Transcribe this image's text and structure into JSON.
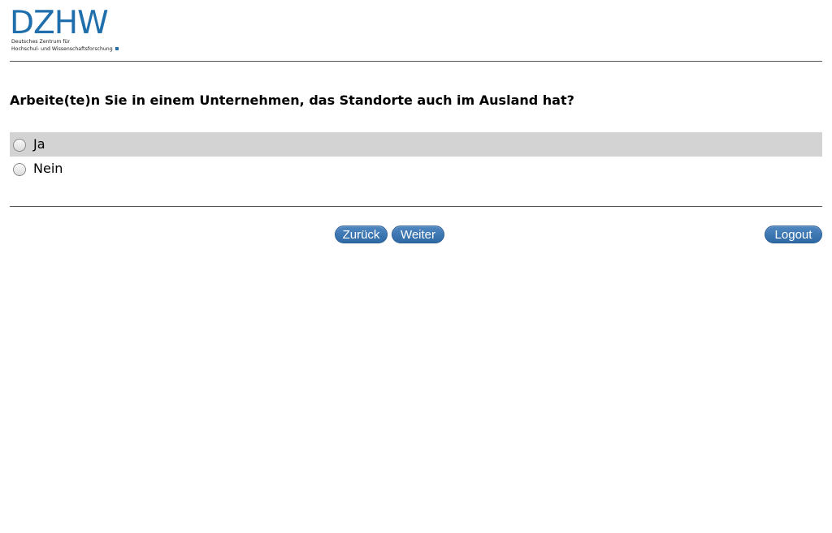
{
  "header": {
    "logo_text": "DZHW",
    "logo_subtitle_line1": "Deutsches Zentrum für",
    "logo_subtitle_line2": "Hochschul- und Wissenschaftsforschung"
  },
  "question": {
    "text": "Arbeite(te)n Sie in einem Unternehmen, das Standorte auch im Ausland hat?"
  },
  "options": [
    {
      "label": "Ja",
      "selected": false
    },
    {
      "label": "Nein",
      "selected": false
    }
  ],
  "navigation": {
    "back_label": "Zurück",
    "next_label": "Weiter",
    "logout_label": "Logout"
  },
  "colors": {
    "brand": "#1f6fad",
    "button": "#3a74b0",
    "highlight_row": "#d3d3d3"
  }
}
